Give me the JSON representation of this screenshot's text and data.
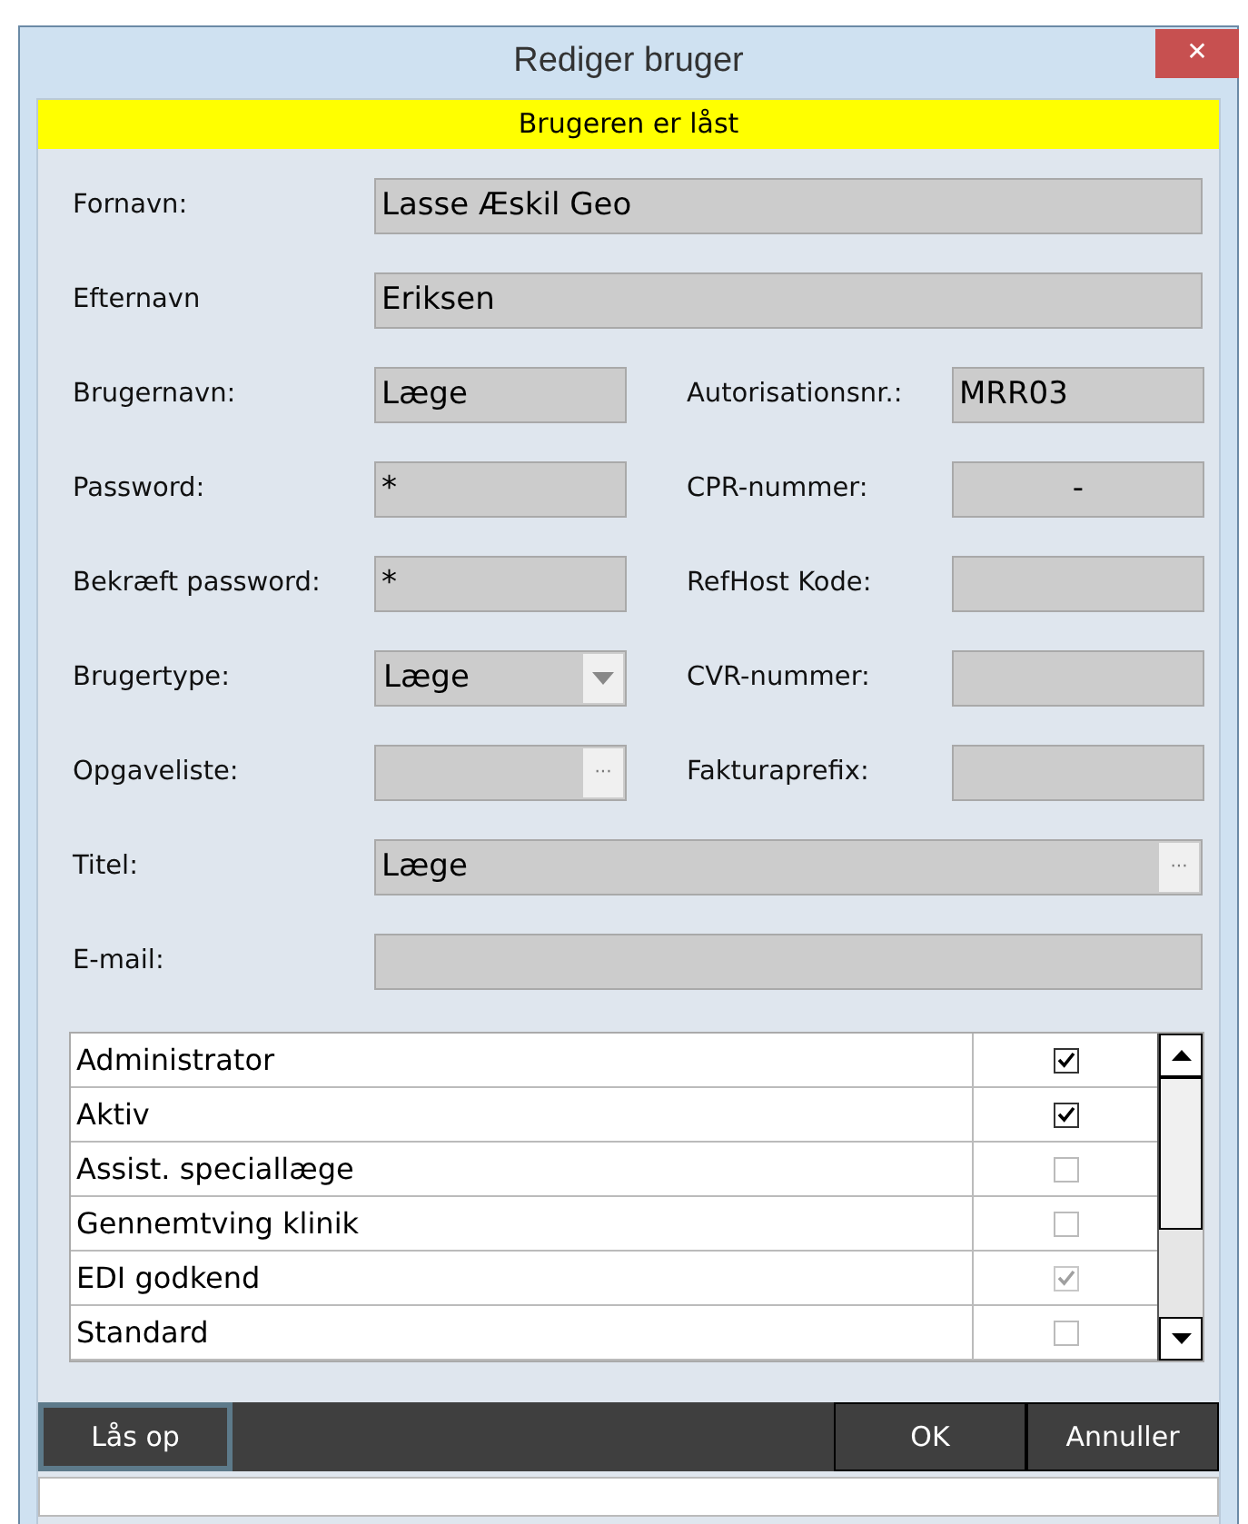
{
  "window": {
    "title": "Rediger bruger",
    "close": "✕"
  },
  "banner": "Brugeren er låst",
  "rows": [
    {
      "fields": [
        {
          "label": "Fornavn:",
          "kind": "text",
          "value": "Lasse Æskil Geo"
        }
      ]
    },
    {
      "fields": [
        {
          "label": "Efternavn",
          "kind": "text",
          "value": "Eriksen"
        }
      ]
    },
    {
      "fields": [
        {
          "label": "Brugernavn:",
          "kind": "text",
          "value": "Læge"
        },
        {
          "label": "Autorisationsnr.:",
          "kind": "text",
          "value": "MRR03"
        }
      ]
    },
    {
      "fields": [
        {
          "label": "Password:",
          "kind": "text",
          "value": "*"
        },
        {
          "label": "CPR-nummer:",
          "kind": "centered",
          "value": "-"
        }
      ]
    },
    {
      "fields": [
        {
          "label": "Bekræft password:",
          "kind": "text",
          "value": "*"
        },
        {
          "label": "RefHost Kode:",
          "kind": "text"
        }
      ]
    },
    {
      "fields": [
        {
          "label": "Brugertype:",
          "kind": "combo",
          "value": "Læge"
        },
        {
          "label": "CVR-nummer:",
          "kind": "text"
        }
      ]
    },
    {
      "fields": [
        {
          "label": "Opgaveliste:",
          "kind": "lookup",
          "button": "···"
        },
        {
          "label": "Fakturaprefix:",
          "kind": "text"
        }
      ]
    },
    {
      "fields": [
        {
          "label": "Titel:",
          "kind": "lookup",
          "value": "Læge",
          "button": "···"
        }
      ]
    },
    {
      "fields": [
        {
          "label": "E-mail:",
          "kind": "text"
        }
      ]
    }
  ],
  "rights": [
    {
      "name": "Administrator",
      "checked": true,
      "disabled": false
    },
    {
      "name": "Aktiv",
      "checked": true,
      "disabled": false
    },
    {
      "name": "Assist. speciallæge",
      "checked": false,
      "disabled": false
    },
    {
      "name": "Gennemtving klinik",
      "checked": false,
      "disabled": false
    },
    {
      "name": "EDI godkend",
      "checked": true,
      "disabled": true
    },
    {
      "name": "Standard",
      "checked": false,
      "disabled": false
    }
  ],
  "buttons": {
    "unlock": {
      "label": "Lås op",
      "focused": true
    },
    "ok": {
      "label": "OK"
    },
    "cancel": {
      "label": "Annuller"
    }
  }
}
